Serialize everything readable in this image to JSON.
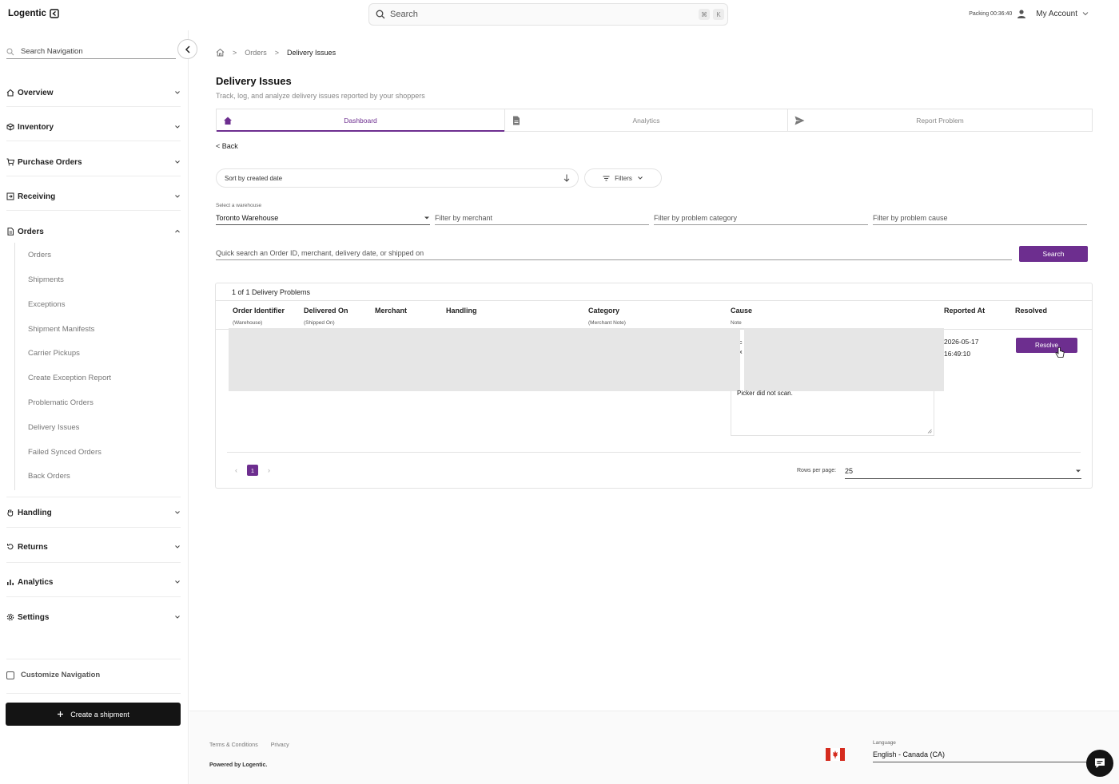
{
  "app": {
    "name": "Logentic"
  },
  "topbar": {
    "search_placeholder": "Search",
    "shortcut_cmd": "⌘",
    "shortcut_key": "K",
    "packing_label": "Packing",
    "packing_timer": "00:36:40",
    "account_label": "My Account"
  },
  "sidebar": {
    "search_placeholder": "Search Navigation",
    "sections": [
      {
        "label": "Overview",
        "icon": "home-icon"
      },
      {
        "label": "Inventory",
        "icon": "box-icon"
      },
      {
        "label": "Purchase Orders",
        "icon": "cart-icon"
      },
      {
        "label": "Receiving",
        "icon": "receive-icon"
      },
      {
        "label": "Orders",
        "icon": "document-icon",
        "expanded": true
      },
      {
        "label": "Handling",
        "icon": "hand-icon"
      },
      {
        "label": "Returns",
        "icon": "return-icon"
      },
      {
        "label": "Analytics",
        "icon": "bar-chart-icon"
      },
      {
        "label": "Settings",
        "icon": "gear-icon"
      }
    ],
    "order_items": [
      "Orders",
      "Shipments",
      "Exceptions",
      "Shipment Manifests",
      "Carrier Pickups",
      "Create Exception Report",
      "Problematic Orders",
      "Delivery Issues",
      "Failed Synced Orders",
      "Back Orders"
    ],
    "customize_label": "Customize Navigation",
    "create_button": "Create a shipment"
  },
  "breadcrumb": {
    "parent": "Orders",
    "current": "Delivery Issues"
  },
  "page": {
    "title": "Delivery Issues",
    "subtitle": "Track, log, and analyze delivery issues reported by your shoppers"
  },
  "tabs": [
    {
      "label": "Dashboard",
      "icon": "home-icon",
      "active": true
    },
    {
      "label": "Analytics",
      "icon": "document-icon",
      "active": false
    },
    {
      "label": "Report Problem",
      "icon": "send-icon",
      "active": false
    }
  ],
  "back_label": "Back",
  "sort": {
    "label": "Sort by created date"
  },
  "filters_label": "Filters",
  "filter_row": {
    "warehouse_label": "Select a warehouse",
    "warehouse_value": "Toronto Warehouse",
    "merchant_placeholder": "Filter by merchant",
    "category_placeholder": "Filter by problem category",
    "cause_placeholder": "Filter by problem cause"
  },
  "quick_search": {
    "placeholder": "Quick search an Order ID, merchant, delivery date, or shipped on",
    "button": "Search"
  },
  "table": {
    "count_label": "1 of 1 Delivery Problems",
    "columns": [
      {
        "label": "Order Identifier",
        "sub": "(Warehouse)"
      },
      {
        "label": "Delivered On",
        "sub": "(Shipped On)"
      },
      {
        "label": "Merchant",
        "sub": ""
      },
      {
        "label": "Handling",
        "sub": ""
      },
      {
        "label": "Category",
        "sub": "(Merchant Note)"
      },
      {
        "label": "Cause",
        "sub": "Note"
      },
      {
        "label": "Reported At",
        "sub": ""
      },
      {
        "label": "Resolved",
        "sub": ""
      }
    ],
    "rows": [
      {
        "note": "Picker did not scan.",
        "reported_date": "2026-05-17",
        "reported_time": "16:49:10",
        "resolve_label": "Resolve"
      }
    ],
    "page": "1",
    "rows_per_page_label": "Rows per page:",
    "rows_per_page": "25"
  },
  "footer": {
    "terms": "Terms & Conditions",
    "privacy": "Privacy",
    "powered": "Powered by Logentic.",
    "language_label": "Language",
    "language_value": "English - Canada (CA)"
  },
  "colors": {
    "accent": "#6d2e8f",
    "dark_button": "#141414",
    "flag_red": "#d52b1e"
  }
}
